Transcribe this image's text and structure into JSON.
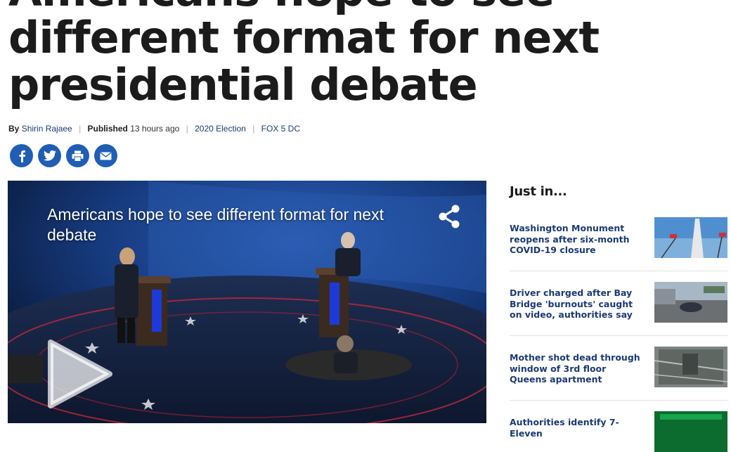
{
  "article": {
    "headline": "Americans hope to see different format for next presidential debate",
    "byline": {
      "by_label": "By",
      "author": "Shirin Rajaee",
      "published_label": "Published",
      "published_time": "13 hours ago",
      "category": "2020 Election",
      "source": "FOX 5 DC"
    },
    "share_buttons": [
      "facebook-icon",
      "twitter-icon",
      "print-icon",
      "email-icon"
    ]
  },
  "video": {
    "title": "Americans hope to see different format for next debate",
    "share_icon": "share-icon",
    "play_icon": "play-icon"
  },
  "sidebar": {
    "title": "Just in...",
    "items": [
      {
        "title": "Washington Monument reopens after six-month COVID-19 closure"
      },
      {
        "title": "Driver charged after Bay Bridge 'burnouts' caught on video, authorities say"
      },
      {
        "title": "Mother shot dead through window of 3rd floor Queens apartment"
      },
      {
        "title": "Authorities identify 7-Eleven"
      }
    ]
  },
  "colors": {
    "share_blue": "#1f5eb4",
    "link_blue": "#1c3a75",
    "headline": "#1b1b1b"
  }
}
